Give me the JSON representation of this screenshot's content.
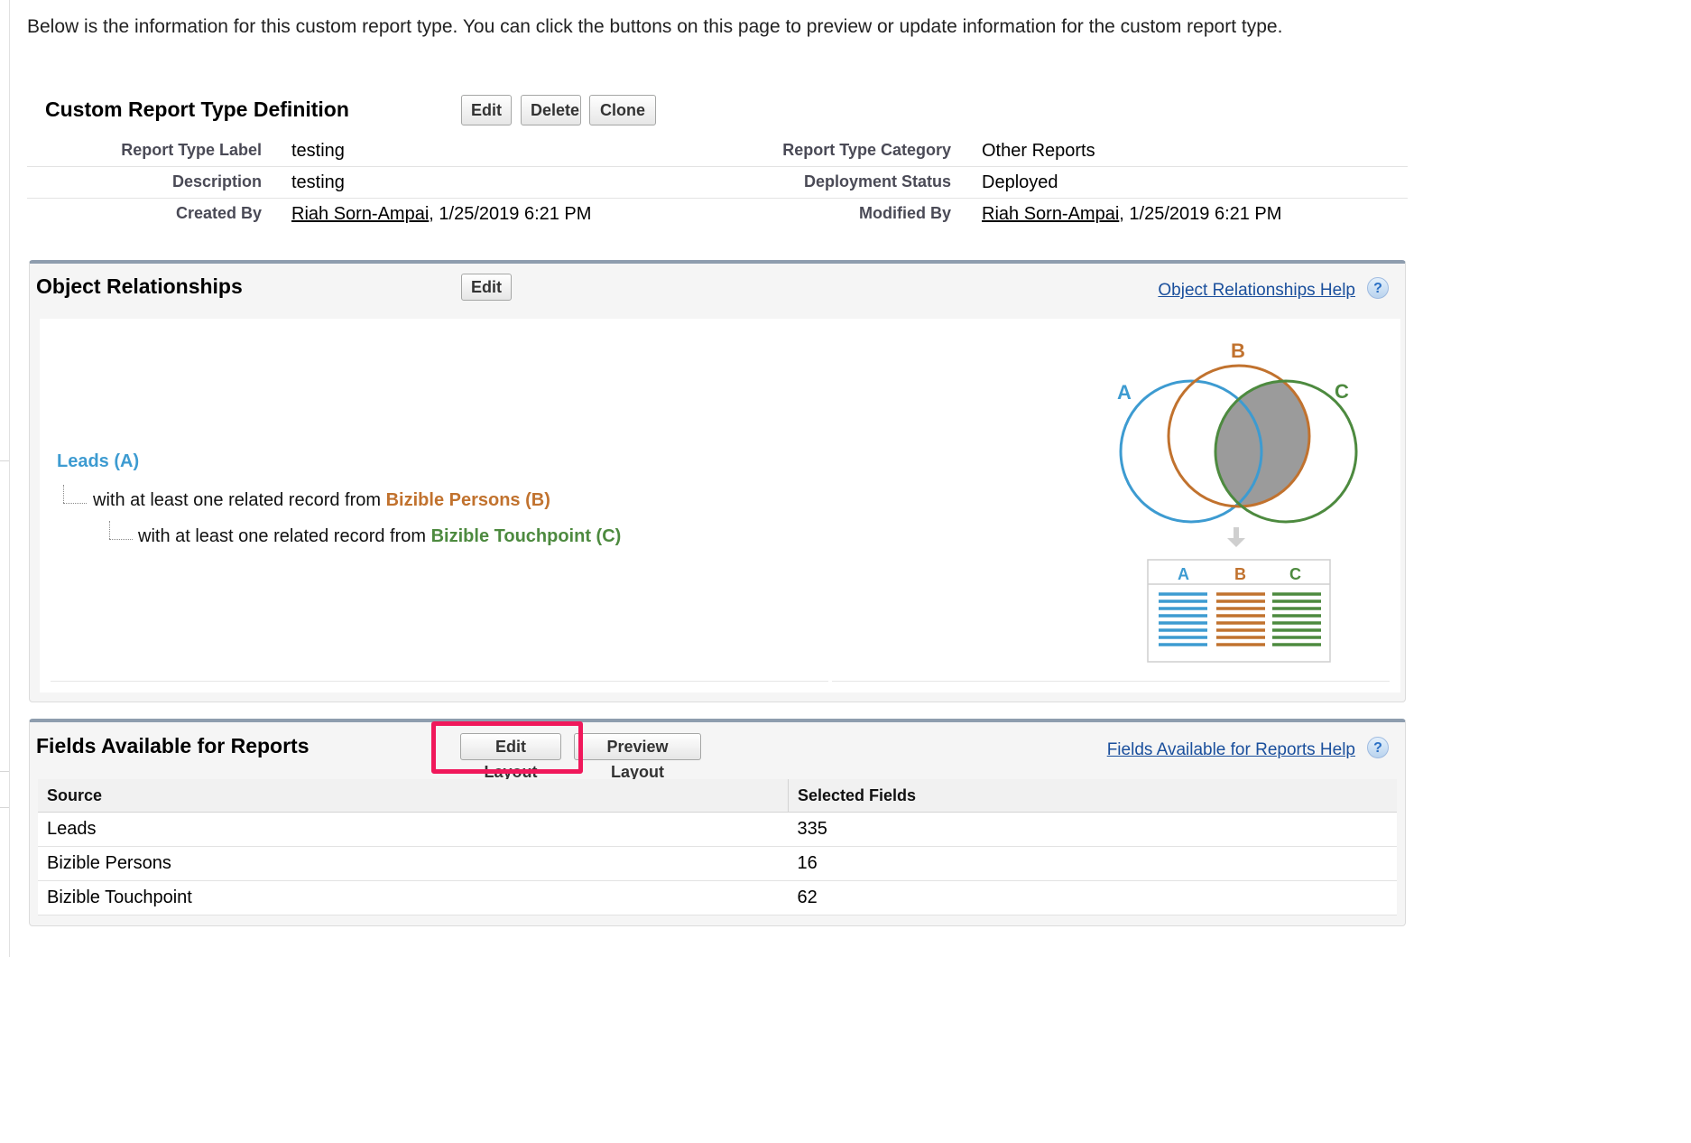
{
  "intro_text": "Below is the information for this custom report type. You can click the buttons on this page to preview or update information for the custom report type.",
  "definition": {
    "title": "Custom Report Type Definition",
    "buttons": {
      "edit": "Edit",
      "delete": "Delete",
      "clone": "Clone"
    },
    "fields": {
      "report_type_label": {
        "label": "Report Type Label",
        "value": "testing"
      },
      "description": {
        "label": "Description",
        "value": "testing"
      },
      "created_by": {
        "label": "Created By",
        "user": "Riah Sorn-Ampai",
        "date": ", 1/25/2019 6:21 PM"
      },
      "report_type_category": {
        "label": "Report Type Category",
        "value": "Other Reports"
      },
      "deployment_status": {
        "label": "Deployment Status",
        "value": "Deployed"
      },
      "modified_by": {
        "label": "Modified By",
        "user": "Riah Sorn-Ampai",
        "date": ", 1/25/2019 6:21 PM"
      }
    }
  },
  "relationships": {
    "title": "Object Relationships",
    "edit_label": "Edit",
    "help_link": "Object Relationships Help",
    "help_icon": "?",
    "primary": "Leads (A)",
    "prefix": "with at least one related record from ",
    "object_b": "Bizible Persons (B)",
    "object_c": "Bizible Touchpoint (C)",
    "diagram": {
      "labels": {
        "a": "A",
        "b": "B",
        "c": "C"
      },
      "colors": {
        "a": "#3d9bd1",
        "b": "#c1722e",
        "c": "#4d8a3f",
        "overlap": "#9b9b9b"
      }
    }
  },
  "fields_available": {
    "title": "Fields Available for Reports",
    "edit_layout": "Edit Layout",
    "preview_layout": "Preview Layout",
    "help_link": "Fields Available for Reports Help",
    "help_icon": "?",
    "columns": [
      "Source",
      "Selected Fields"
    ],
    "rows": [
      {
        "source": "Leads",
        "count": "335"
      },
      {
        "source": "Bizible Persons",
        "count": "16"
      },
      {
        "source": "Bizible Touchpoint",
        "count": "62"
      }
    ],
    "highlight_color": "#f0185b"
  }
}
